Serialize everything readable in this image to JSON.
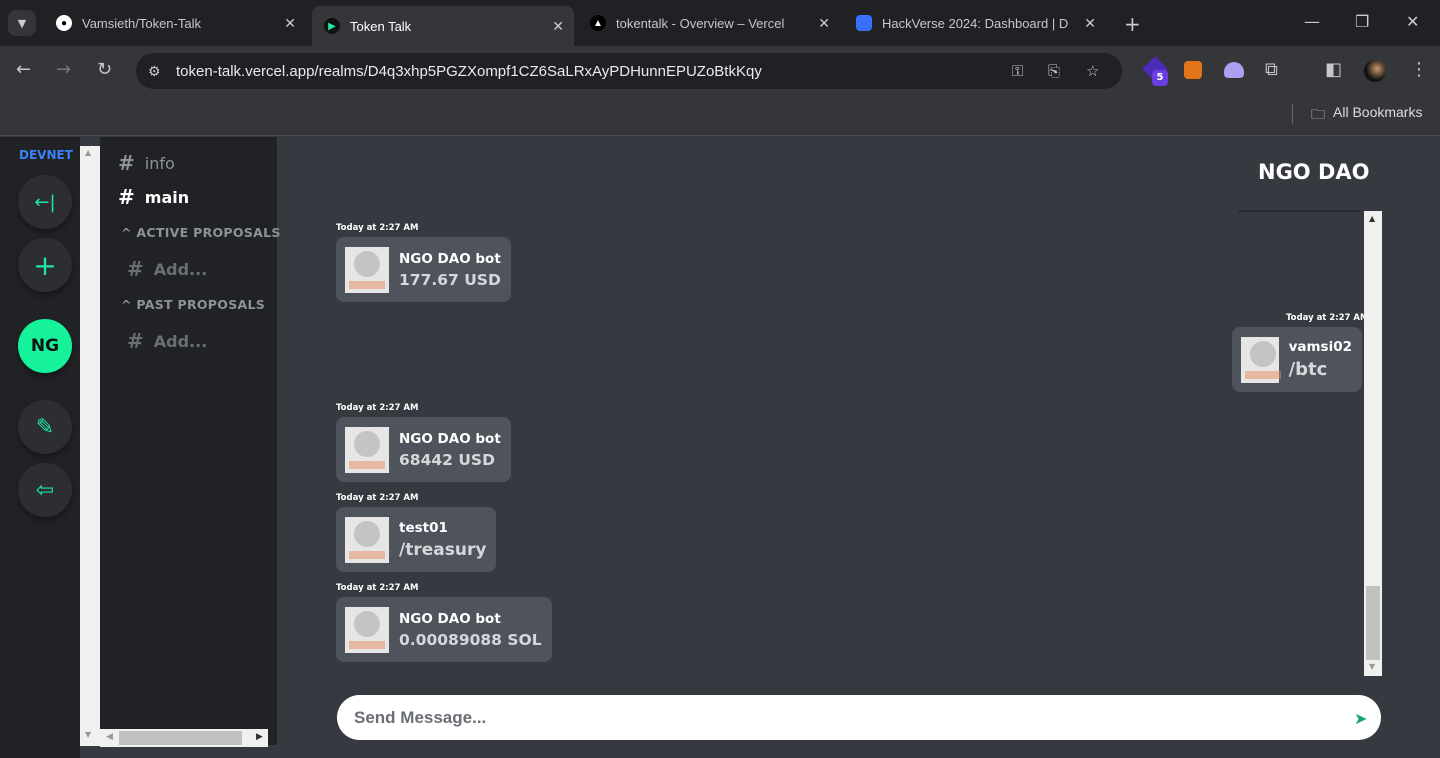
{
  "browser": {
    "tabs": [
      {
        "title": "Vamsieth/Token-Talk",
        "icon": "github-icon",
        "active": false
      },
      {
        "title": "Token Talk",
        "icon": "play-icon",
        "active": true
      },
      {
        "title": "tokentalk - Overview – Vercel",
        "icon": "vercel-icon",
        "active": false
      },
      {
        "title": "HackVerse 2024: Dashboard | D",
        "icon": "devfolio-icon",
        "active": false
      }
    ],
    "url": "token-talk.vercel.app/realms/D4q3xhp5PGZXompf1CZ6SaLRxAyPDHunnEPUZoBtkKqy",
    "extension_badge": "5",
    "bookmarks_label": "All Bookmarks"
  },
  "rail": {
    "network": "DEVNET",
    "realm_initials": "NG",
    "accent": "#1de9a0"
  },
  "channels": {
    "items": [
      {
        "label": "info",
        "active": false
      },
      {
        "label": "main",
        "active": true
      }
    ],
    "active_section": "^ ACTIVE PROPOSALS",
    "active_add": "Add...",
    "past_section": "^ PAST PROPOSALS",
    "past_add": "Add..."
  },
  "chat": {
    "title": "NGO DAO",
    "messages": [
      {
        "time": "Today at 2:27 AM",
        "user": "NGO DAO bot",
        "text": "177.67 USD",
        "side": "left"
      },
      {
        "time": "Today at 2:27 AM",
        "user": "vamsi02",
        "text": "/btc",
        "side": "right"
      },
      {
        "time": "Today at 2:27 AM",
        "user": "NGO DAO bot",
        "text": "68442 USD",
        "side": "left"
      },
      {
        "time": "Today at 2:27 AM",
        "user": "test01",
        "text": "/treasury",
        "side": "left"
      },
      {
        "time": "Today at 2:27 AM",
        "user": "NGO DAO bot",
        "text": "0.00089088 SOL",
        "side": "left"
      }
    ],
    "input_placeholder": "Send Message..."
  }
}
